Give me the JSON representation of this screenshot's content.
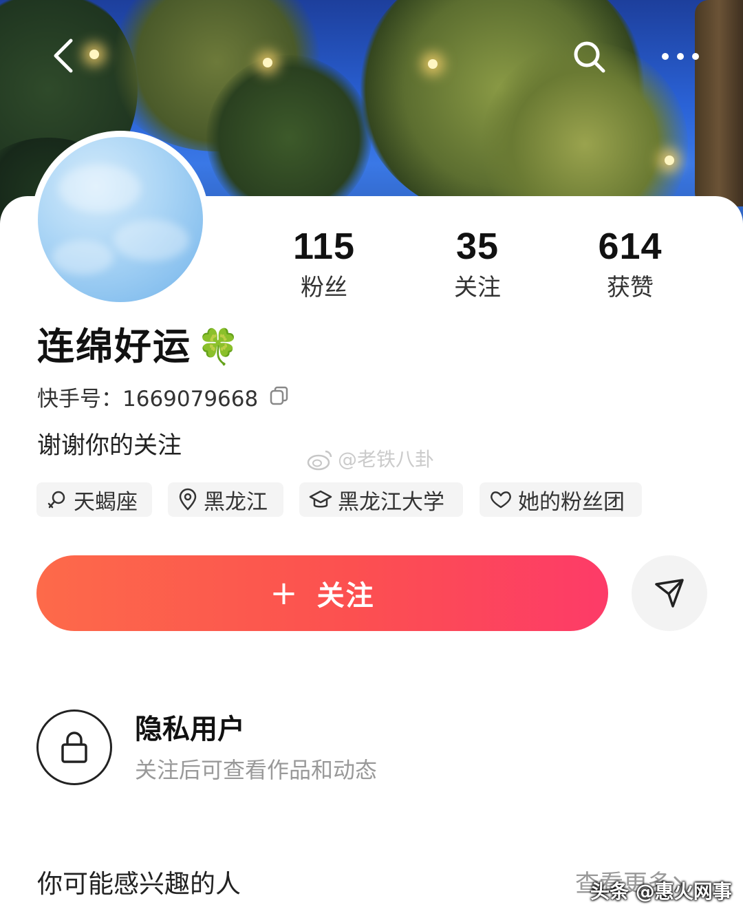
{
  "header": {
    "back_icon": "chevron-left-icon",
    "search_icon": "search-icon",
    "more_icon": "more-horizontal-icon"
  },
  "profile": {
    "name": "连绵好运",
    "name_emoji": "🍀",
    "id_label": "快手号：",
    "id_value": "1669079668",
    "bio": "谢谢你的关注"
  },
  "stats": [
    {
      "value": "115",
      "label": "粉丝"
    },
    {
      "value": "35",
      "label": "关注"
    },
    {
      "value": "614",
      "label": "获赞"
    }
  ],
  "tags": [
    {
      "icon": "constellation-icon",
      "label": "天蝎座"
    },
    {
      "icon": "location-pin-icon",
      "label": "黑龙江"
    },
    {
      "icon": "graduation-cap-icon",
      "label": "黑龙江大学"
    },
    {
      "icon": "fan-group-heart-icon",
      "label": "她的粉丝团"
    }
  ],
  "watermark": "@老铁八卦",
  "actions": {
    "follow_plus": "+",
    "follow_label": "关注",
    "share_icon": "send-icon"
  },
  "private": {
    "icon": "lock-icon",
    "title": "隐私用户",
    "subtitle": "关注后可查看作品和动态"
  },
  "suggestions": {
    "title": "你可能感兴趣的人",
    "more_label": "查看更多"
  },
  "credit": "头条 @惠火网事",
  "colors": {
    "follow_gradient_start": "#fd6a4a",
    "follow_gradient_end": "#fd3b68",
    "secondary_text": "#999999"
  }
}
